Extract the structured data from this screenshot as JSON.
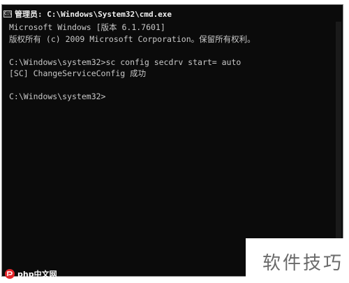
{
  "window": {
    "title": "管理员: C:\\Windows\\System32\\cmd.exe",
    "icon": "cmd-icon"
  },
  "console": {
    "lines": [
      "Microsoft Windows [版本 6.1.7601]",
      "版权所有 (c) 2009 Microsoft Corporation。保留所有权利。",
      "",
      "C:\\Windows\\system32>sc config secdrv start= auto",
      "[SC] ChangeServiceConfig 成功",
      "",
      "C:\\Windows\\system32>"
    ]
  },
  "watermark": {
    "text": "软件技巧"
  },
  "logo": {
    "text": "php中文网"
  },
  "colors": {
    "console_bg": "#0b0b0b",
    "console_text": "#c8c8c8",
    "window_border": "#8a8a8a"
  }
}
